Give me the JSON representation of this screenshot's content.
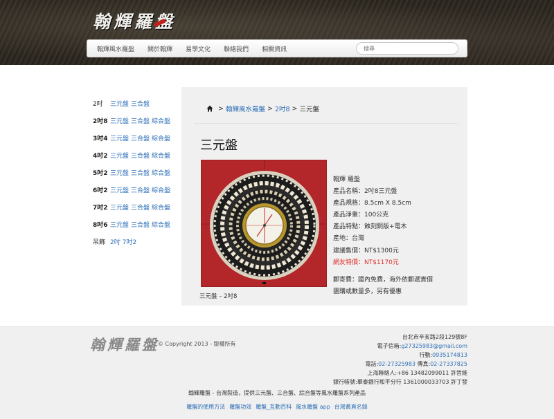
{
  "header": {
    "logo_text": "翰輝羅盤",
    "nav": [
      "翰輝風水羅盤",
      "關於翰輝",
      "易學文化",
      "聯絡我們",
      "相關資訊"
    ],
    "search_placeholder": "搜尋"
  },
  "sidebar": {
    "rows": [
      {
        "size": "2吋",
        "links": [
          "三元盤",
          "三合盤"
        ]
      },
      {
        "size": "2吋8",
        "links": [
          "三元盤",
          "三合盤",
          "綜合盤"
        ]
      },
      {
        "size": "3吋4",
        "links": [
          "三元盤",
          "三合盤",
          "綜合盤"
        ]
      },
      {
        "size": "4吋2",
        "links": [
          "三元盤",
          "三合盤",
          "綜合盤"
        ]
      },
      {
        "size": "5吋2",
        "links": [
          "三元盤",
          "三合盤",
          "綜合盤"
        ]
      },
      {
        "size": "6吋2",
        "links": [
          "三元盤",
          "三合盤",
          "綜合盤"
        ]
      },
      {
        "size": "7吋2",
        "links": [
          "三元盤",
          "三合盤",
          "綜合盤"
        ]
      },
      {
        "size": "8吋6",
        "links": [
          "三元盤",
          "三合盤",
          "綜合盤"
        ]
      },
      {
        "size": "吊飾",
        "links": [
          "2吋",
          "7吋2"
        ]
      }
    ]
  },
  "breadcrumb": {
    "items": [
      "翰輝風水羅盤",
      "2吋8"
    ],
    "current": "三元盤",
    "separator": ">"
  },
  "product": {
    "title": "三元盤",
    "caption": "三元盤 – 2吋8",
    "details": [
      "翰輝 羅盤",
      "產品名稱：2吋8三元盤",
      "產品規格：8.5cm X 8.5cm",
      "產品淨重：100公克",
      "產品特點：蝕刻銅版+電木",
      "產地：台灣",
      "建議售價：NT$1300元",
      "網友特價：NT$1170元",
      "郵寄費：國內免費，海外依郵遞實價",
      "團購或數量多，另有優惠"
    ]
  },
  "footer": {
    "logo_text": "翰輝羅盤",
    "copyright": "© Copyright 2013 - 版權所有",
    "address": "台北市辛亥路2段129號8F",
    "email_label": "電子信箱:",
    "email": "g27325983@gmail.com",
    "mobile_label": "行動:",
    "mobile": "0935174813",
    "phone_label": "電話:",
    "phone": "02-27325983",
    "fax_label": " 傳真:",
    "fax": "02-27337825",
    "shanghai": "上海聯絡人:+86 13482099011 許哲維",
    "bank": "銀行帳號:華泰銀行和平分行 1361000033703 許丁發",
    "tagline": "翰輝羅盤 - 台灣製造，提供三元盤、三合盤、綜合盤等風水羅盤系列產品",
    "links": [
      "羅盤的使用方法",
      "羅盤功效",
      "羅盤_互動百科",
      "風水羅盤 app",
      "台灣黃頁名錄"
    ]
  },
  "colors": {
    "accent_link": "#2a6db6",
    "sale_price": "#e02b2b",
    "disc_red": "#b3272a"
  }
}
